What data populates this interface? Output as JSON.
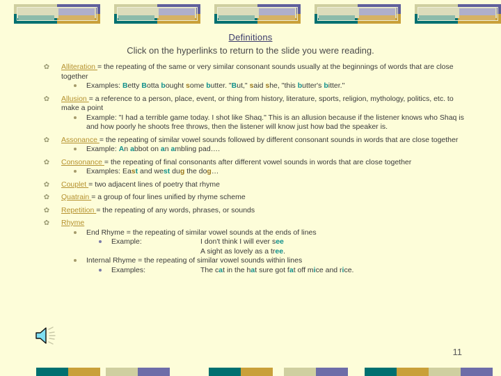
{
  "slide": {
    "title": "Definitions",
    "subtitle": "Click on the hyperlinks to return to the slide you were reading.",
    "page_number": "11",
    "background_color": "#FDFDD9",
    "link_color": "#B5912E",
    "title_color": "#3B3B6B",
    "accent_teal": "#007070",
    "accent_gold": "#C9A03A",
    "accent_purple": "#5F5F9B",
    "accent_olive": "#CFCFA0",
    "speaker_icon": "speaker-sound-icon"
  },
  "entries": [
    {
      "term": "Alliteration",
      "definition": "= the repeating of the same or very similar consonant sounds usually at the beginnings of words that are close together",
      "example_label": "Examples:",
      "example_segments": [
        {
          "t": " ",
          "c": ""
        },
        {
          "t": "B",
          "c": "teal"
        },
        {
          "t": "etty ",
          "c": ""
        },
        {
          "t": "B",
          "c": "teal"
        },
        {
          "t": "otta ",
          "c": ""
        },
        {
          "t": "b",
          "c": "teal"
        },
        {
          "t": "ought ",
          "c": ""
        },
        {
          "t": "s",
          "c": "gold"
        },
        {
          "t": "ome ",
          "c": ""
        },
        {
          "t": "b",
          "c": "teal"
        },
        {
          "t": "utter.  \"",
          "c": ""
        },
        {
          "t": "B",
          "c": "teal"
        },
        {
          "t": "ut,\" ",
          "c": ""
        },
        {
          "t": "s",
          "c": "gold"
        },
        {
          "t": "aid ",
          "c": ""
        },
        {
          "t": "s",
          "c": "gold"
        },
        {
          "t": "he, \"this ",
          "c": ""
        },
        {
          "t": "b",
          "c": "teal"
        },
        {
          "t": "utter's ",
          "c": ""
        },
        {
          "t": "b",
          "c": "teal"
        },
        {
          "t": "itter.\"",
          "c": ""
        }
      ]
    },
    {
      "term": "Allusion",
      "definition": "= a reference to a person, place, event, or thing from history, literature, sports, religion, mythology, politics, etc. to make a point",
      "example_label": "Example:",
      "example_segments": [
        {
          "t": "  \"I had a terrible game today.  I shot like Shaq.\"  This is an allusion because if the listener knows who Shaq is and how poorly he shoots free throws, then the listener will know just how bad the speaker is.",
          "c": ""
        }
      ]
    },
    {
      "term": "Assonance",
      "definition": "= the repeating of similar vowel sounds followed by different consonant sounds in words that are close together",
      "example_label": "Example:",
      "example_segments": [
        {
          "t": " ",
          "c": ""
        },
        {
          "t": "A",
          "c": "teal"
        },
        {
          "t": "n ",
          "c": ""
        },
        {
          "t": "a",
          "c": "teal"
        },
        {
          "t": "bbot on ",
          "c": ""
        },
        {
          "t": "a",
          "c": "teal"
        },
        {
          "t": "n ",
          "c": ""
        },
        {
          "t": "a",
          "c": "teal"
        },
        {
          "t": "mbling pad….",
          "c": ""
        }
      ]
    },
    {
      "term": "Consonance",
      "definition": "= the repeating of final consonants after different vowel sounds in words that are close together",
      "example_label": "Examples:",
      "example_segments": [
        {
          "t": " Ea",
          "c": ""
        },
        {
          "t": "s",
          "c": "gold"
        },
        {
          "t": "t",
          "c": "teal"
        },
        {
          "t": " and we",
          "c": ""
        },
        {
          "t": "s",
          "c": "teal"
        },
        {
          "t": "t",
          "c": "teal"
        },
        {
          "t": " du",
          "c": ""
        },
        {
          "t": "g",
          "c": "gold"
        },
        {
          "t": " the do",
          "c": ""
        },
        {
          "t": "g",
          "c": "gold"
        },
        {
          "t": "…",
          "c": ""
        }
      ]
    },
    {
      "term": "Couplet",
      "definition": "= two adjacent lines of poetry that rhyme",
      "example_label": "",
      "example_segments": []
    },
    {
      "term": "Quatrain",
      "definition": "= a group of four lines unified by rhyme scheme",
      "example_label": "",
      "example_segments": []
    },
    {
      "term": "Repetition",
      "definition": "= the repeating of any words, phrases, or sounds",
      "example_label": "",
      "example_segments": []
    }
  ],
  "rhyme": {
    "term": "Rhyme",
    "end_rhyme": {
      "definition": "End Rhyme = the repeating of similar vowel sounds at the ends of lines",
      "example_label": "Example:",
      "lines": [
        [
          {
            "t": "I don't think I will ever s",
            "c": ""
          },
          {
            "t": "ee",
            "c": "teal"
          }
        ],
        [
          {
            "t": "A sight as lovely as a tr",
            "c": ""
          },
          {
            "t": "ee",
            "c": "teal"
          },
          {
            "t": ".",
            "c": ""
          }
        ]
      ]
    },
    "internal_rhyme": {
      "definition": "Internal Rhyme = the repeating of similar vowel sounds within lines",
      "example_label": "Examples:",
      "lines": [
        [
          {
            "t": "The c",
            "c": ""
          },
          {
            "t": "a",
            "c": "teal"
          },
          {
            "t": "t in the h",
            "c": ""
          },
          {
            "t": "a",
            "c": "teal"
          },
          {
            "t": "t sure got f",
            "c": ""
          },
          {
            "t": "a",
            "c": "teal"
          },
          {
            "t": "t off m",
            "c": ""
          },
          {
            "t": "i",
            "c": "teal"
          },
          {
            "t": "ce and r",
            "c": ""
          },
          {
            "t": "i",
            "c": "teal"
          },
          {
            "t": "ce.",
            "c": ""
          }
        ]
      ]
    }
  }
}
